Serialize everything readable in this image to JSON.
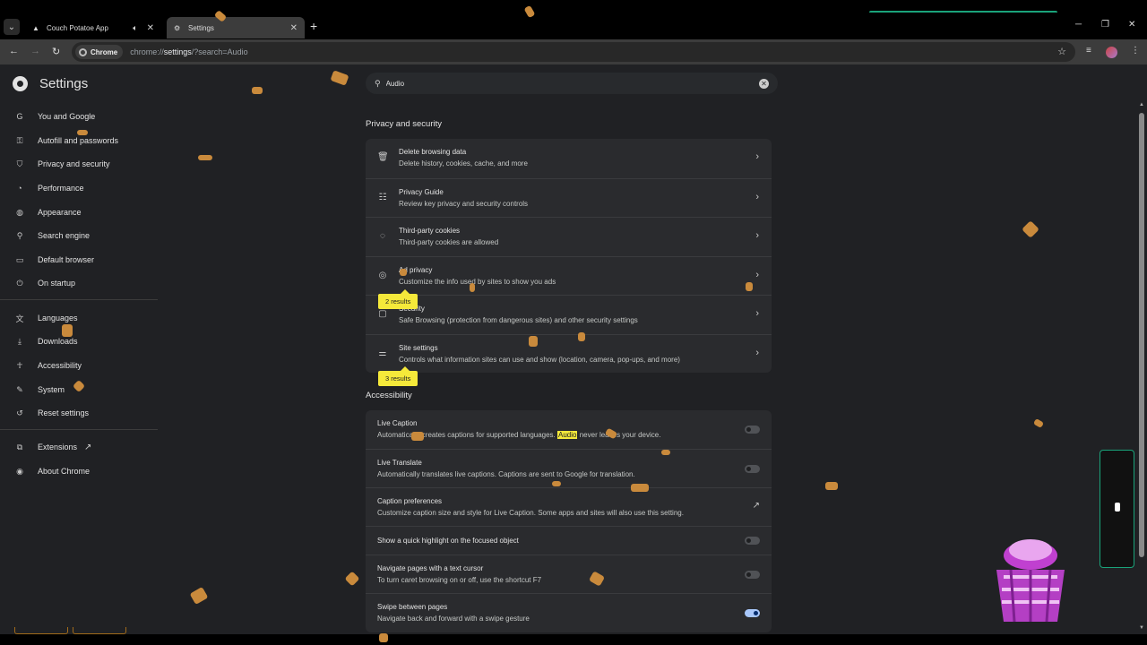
{
  "browser": {
    "tabs": [
      {
        "title": "Couch Potatoe App",
        "icon": "triangle-icon",
        "extra_icon": "speaker-icon",
        "active": false
      },
      {
        "title": "Settings",
        "icon": "gear-icon",
        "active": true
      }
    ],
    "chip": "Chrome",
    "url_prefix": "chrome://",
    "url_bold": "settings",
    "url_suffix": "/?search=Audio"
  },
  "settings": {
    "title": "Settings",
    "search_value": "Audio",
    "sidebar": [
      {
        "label": "You and Google",
        "icon": "google-icon"
      },
      {
        "label": "Autofill and passwords",
        "icon": "key-icon"
      },
      {
        "label": "Privacy and security",
        "icon": "shield-icon"
      },
      {
        "label": "Performance",
        "icon": "speedometer-icon"
      },
      {
        "label": "Appearance",
        "icon": "palette-icon"
      },
      {
        "label": "Search engine",
        "icon": "search-icon"
      },
      {
        "label": "Default browser",
        "icon": "browser-icon"
      },
      {
        "label": "On startup",
        "icon": "power-icon"
      },
      {
        "label": "Languages",
        "icon": "translate-icon"
      },
      {
        "label": "Downloads",
        "icon": "download-icon"
      },
      {
        "label": "Accessibility",
        "icon": "accessibility-icon"
      },
      {
        "label": "System",
        "icon": "wrench-icon"
      },
      {
        "label": "Reset settings",
        "icon": "reset-icon"
      },
      {
        "label": "Extensions",
        "icon": "puzzle-icon"
      },
      {
        "label": "About Chrome",
        "icon": "chrome-icon"
      }
    ],
    "privacy": {
      "heading": "Privacy and security",
      "rows": [
        {
          "title": "Delete browsing data",
          "subtitle": "Delete history, cookies, cache, and more",
          "icon": "trash-icon"
        },
        {
          "title": "Privacy Guide",
          "subtitle": "Review key privacy and security controls",
          "icon": "privacy-guide-icon"
        },
        {
          "title": "Third-party cookies",
          "subtitle": "Third-party cookies are allowed",
          "icon": "cookie-icon"
        },
        {
          "title": "Ad privacy",
          "subtitle": "Customize the info used by sites to show you ads",
          "icon": "ad-privacy-icon"
        },
        {
          "title": "Security",
          "subtitle": "Safe Browsing (protection from dangerous sites) and other security settings",
          "icon": "lock-icon"
        },
        {
          "title": "Site settings",
          "subtitle": "Controls what information sites can use and show (location, camera, pop-ups, and more)",
          "icon": "sliders-icon"
        }
      ],
      "badges": [
        "2 results",
        "3 results"
      ]
    },
    "accessibility": {
      "heading": "Accessibility",
      "live_caption": {
        "title": "Live Caption",
        "sub_before": "Automatically creates captions for supported languages.",
        "sub_highlight": "Audio",
        "sub_after": "never leaves your device."
      },
      "rows": [
        {
          "title": "Live Translate",
          "subtitle": "Automatically translates live captions. Captions are sent to Google for translation."
        },
        {
          "title": "Caption preferences",
          "subtitle": "Customize caption size and style for Live Caption. Some apps and sites will also use this setting."
        },
        {
          "title": "Show a quick highlight on the focused object",
          "subtitle": ""
        },
        {
          "title": "Navigate pages with a text cursor",
          "subtitle": "To turn caret browsing on or off, use the shortcut F7"
        },
        {
          "title": "Swipe between pages",
          "subtitle": "Navigate back and forward with a swipe gesture"
        }
      ],
      "toggles": {
        "live_caption": false,
        "live_translate": false,
        "quick_highlight": false,
        "caret_browsing": false,
        "swipe_pages": true
      }
    }
  },
  "colors": {
    "accent": "#a8c7fa",
    "highlight": "#f5e93a",
    "page_bg": "#202124",
    "card_bg": "#2a2b2e",
    "overlay_crumb": "#c98a3c"
  }
}
